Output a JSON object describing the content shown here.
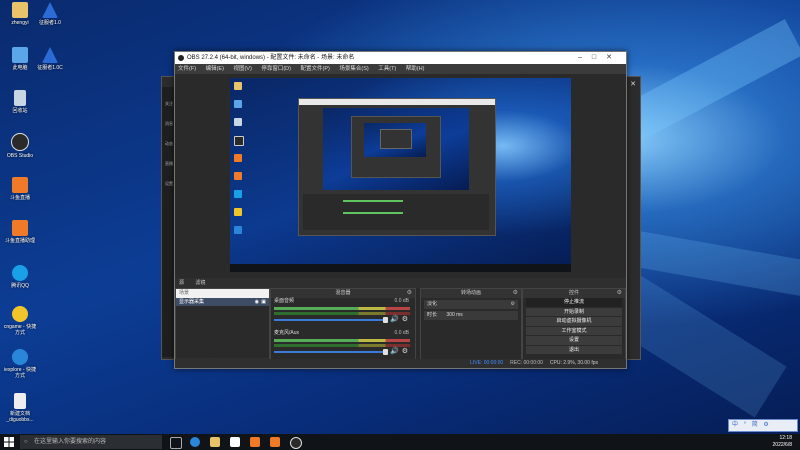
{
  "desktop": {
    "icons": [
      {
        "label": "zhengyi",
        "name": "user-folder-icon",
        "color": "#e8c36a"
      },
      {
        "label": "征服者1.0",
        "name": "app-launcher-icon",
        "color": "#2c6bd6"
      },
      {
        "label": "此电脑",
        "name": "this-pc-icon",
        "color": "#5aa6e8"
      },
      {
        "label": "征服者1.0C",
        "name": "app-launcher-icon-2",
        "color": "#2c6bd6"
      },
      {
        "label": "回收站",
        "name": "recycle-bin-icon",
        "color": "#c9d6e3"
      },
      {
        "label": "OBS Studio",
        "name": "obs-studio-icon",
        "color": "#2a2a2a"
      },
      {
        "label": "斗鱼直播",
        "name": "douyu-live-icon",
        "color": "#f07a28"
      },
      {
        "label": "斗鱼直播助理",
        "name": "douyu-assistant-icon",
        "color": "#f07a28"
      },
      {
        "label": "腾讯QQ",
        "name": "qq-icon",
        "color": "#1aa0e6"
      },
      {
        "label": "cngame - 快捷方式",
        "name": "cngame-shortcut-icon",
        "color": "#f1c52a"
      },
      {
        "label": "iexplore - 快捷方式",
        "name": "ie-shortcut-icon",
        "color": "#2a86d9"
      },
      {
        "label": "新建文档_diguobbs...",
        "name": "document-icon",
        "color": "#eeeeee"
      }
    ]
  },
  "obs": {
    "title": "OBS 27.2.4 (64-bit, windows) - 配置文件: 未命名 - 场景: 未命名",
    "menu": [
      "文件(F)",
      "编辑(E)",
      "视图(V)",
      "停靠窗口(D)",
      "配置文件(P)",
      "场景集合(S)",
      "工具(T)",
      "帮助(H)"
    ],
    "docks_tabs": [
      "源",
      "滤镜"
    ],
    "scenes": {
      "header": "场景"
    },
    "sources": {
      "header": "来源",
      "items": [
        {
          "label": "显示器采集"
        }
      ],
      "footer_icons": "+ − ⚙ ∧ ∨"
    },
    "mixer": {
      "header": "混音器",
      "tracks": [
        {
          "name": "桌面音频",
          "db": "0.0 dB"
        },
        {
          "name": "麦克风/Aux",
          "db": "0.0 dB"
        }
      ]
    },
    "transitions": {
      "header": "转场动画",
      "type": "淡化",
      "duration_label": "时长",
      "duration_value": "300 ms"
    },
    "controls": {
      "header": "控件",
      "buttons": [
        "停止推流",
        "开始录制",
        "启动虚拟摄像机",
        "工作室模式",
        "设置",
        "退出"
      ]
    },
    "status": {
      "live": "LIVE: 00:00:00",
      "rec": "REC: 00:00:00",
      "cpu": "CPU: 2.9%, 30.00 fps"
    }
  },
  "obs_back": {
    "sidebar": [
      "关注",
      "消息",
      "动态",
      "直播",
      "设置"
    ]
  },
  "taskbar": {
    "search_placeholder": "在这里输入你要搜索的内容",
    "time": "12:18",
    "date": "2022/6/8",
    "tray_text": "中 ° 简 ⚙"
  }
}
